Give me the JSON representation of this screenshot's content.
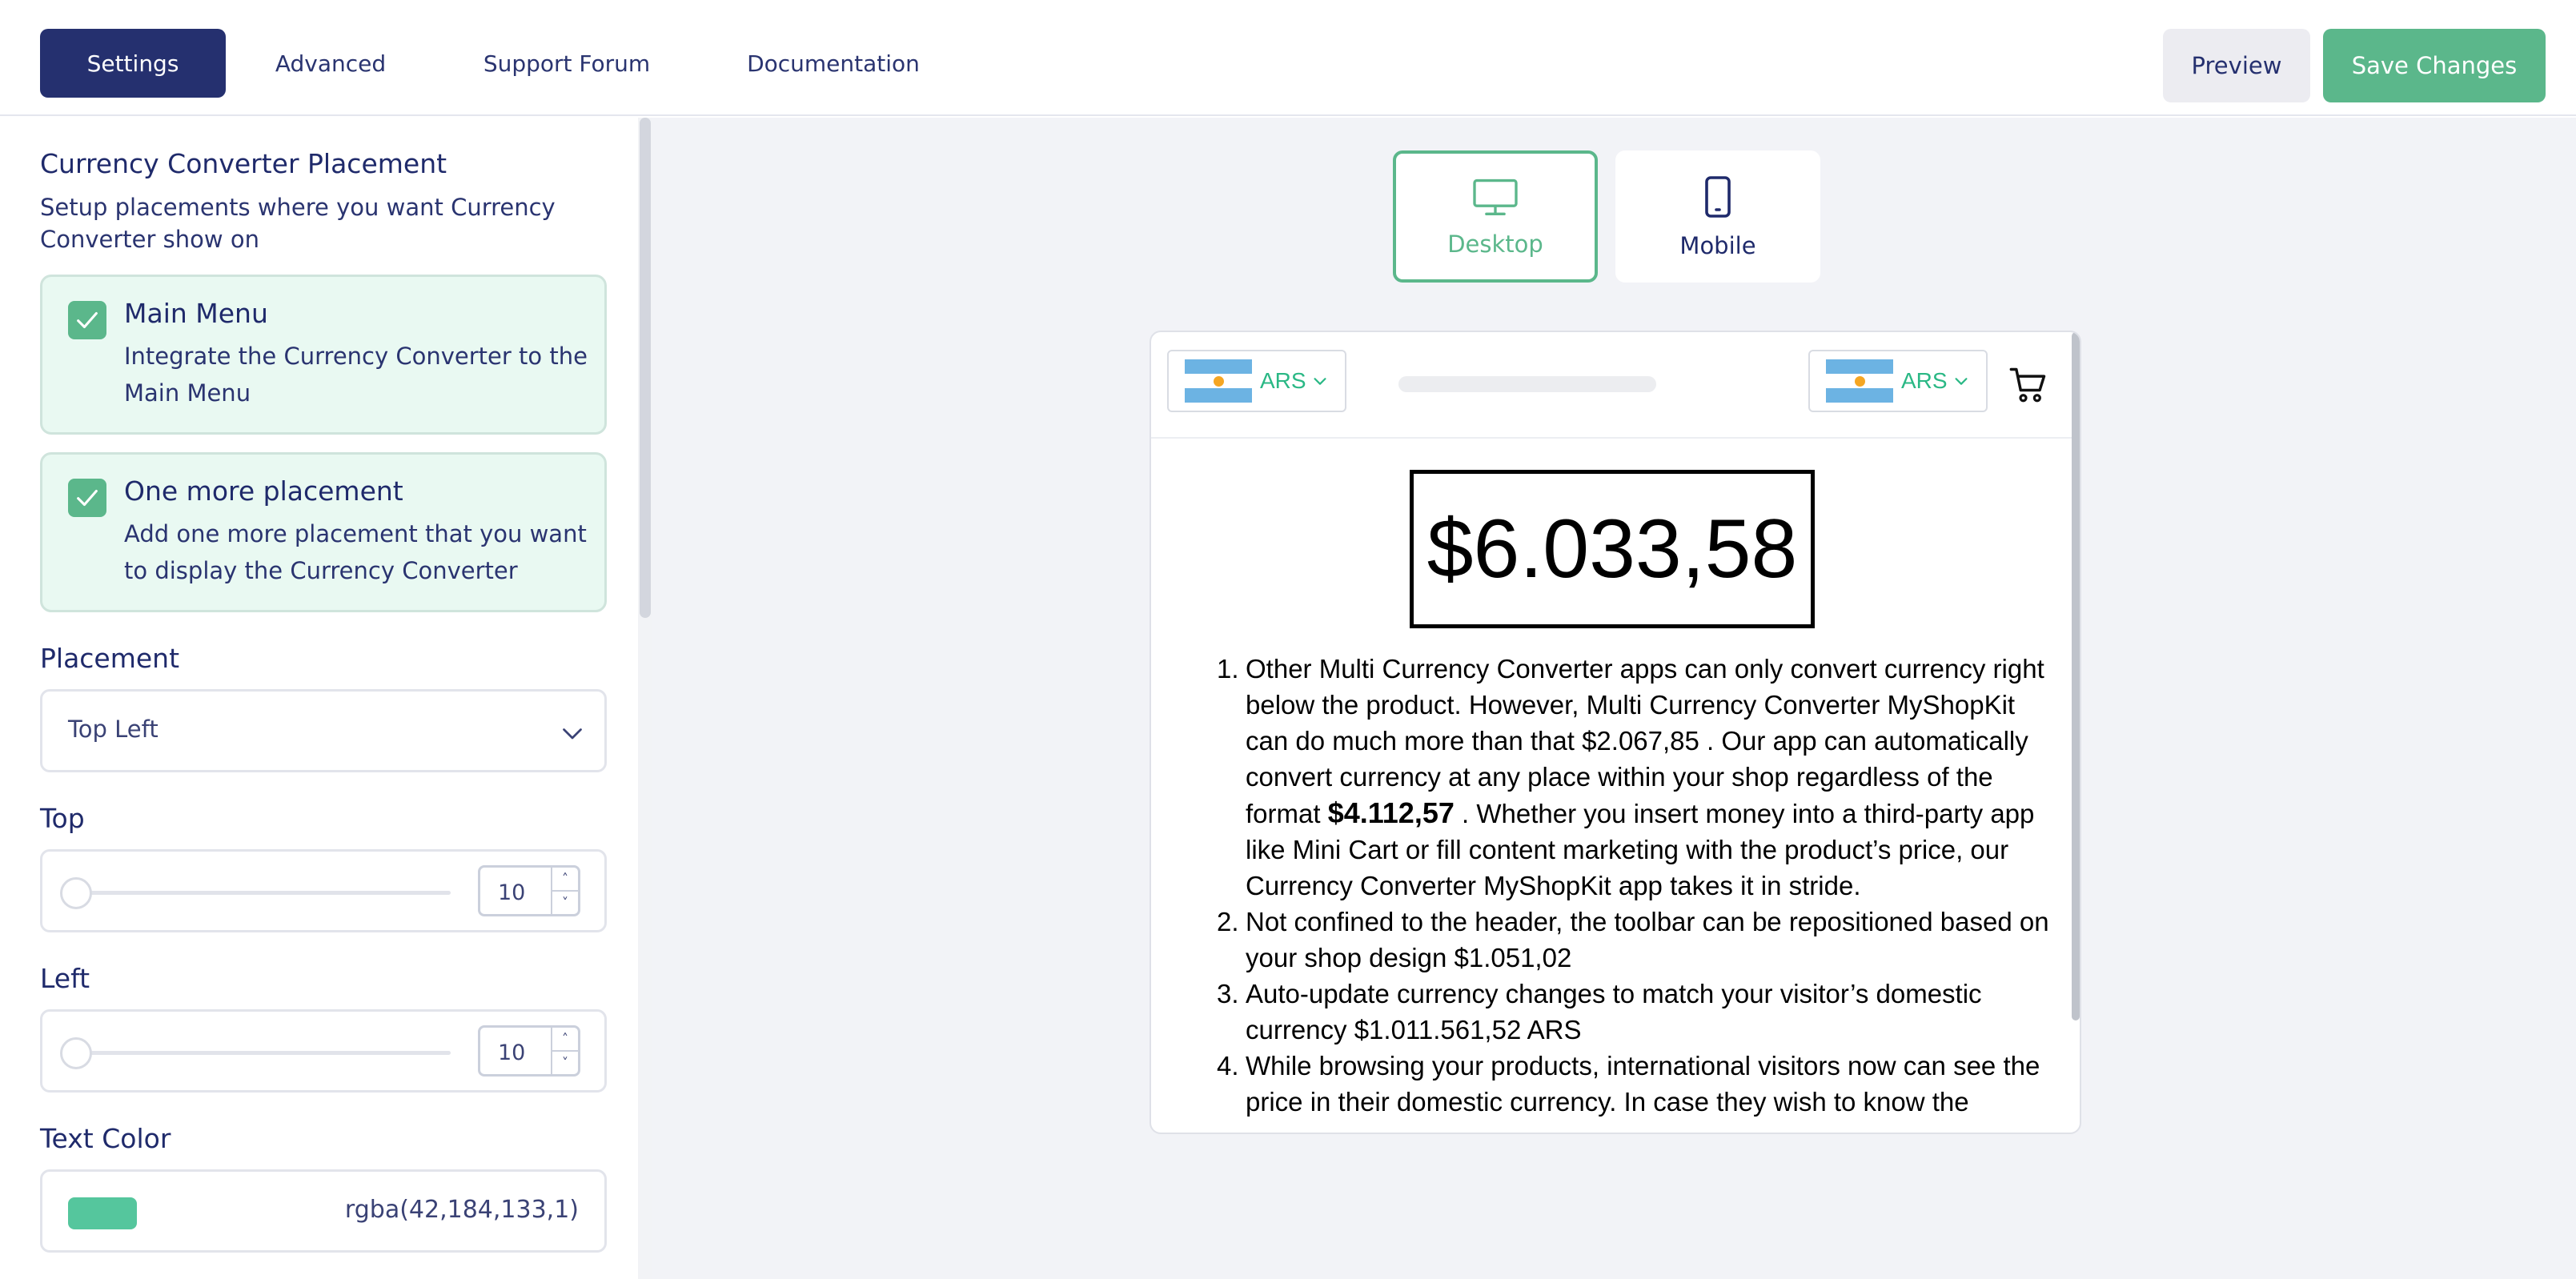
{
  "top_nav": {
    "tabs": [
      {
        "label": "Settings",
        "active": true
      },
      {
        "label": "Advanced",
        "active": false
      },
      {
        "label": "Support Forum",
        "active": false
      },
      {
        "label": "Documentation",
        "active": false
      }
    ],
    "preview_label": "Preview",
    "save_label": "Save Changes"
  },
  "sidebar": {
    "section_title": "Currency Converter Placement",
    "section_desc": "Setup placements where you want Currency Converter show on",
    "cards": [
      {
        "title": "Main Menu",
        "desc": "Integrate the Currency Converter to the Main Menu",
        "checked": true
      },
      {
        "title": "One more placement",
        "desc": "Add one more placement that you want to display the Currency Converter",
        "checked": true
      }
    ],
    "placement": {
      "label": "Placement",
      "value": "Top Left"
    },
    "top": {
      "label": "Top",
      "value": "10",
      "up": "˄",
      "down": "˅"
    },
    "left": {
      "label": "Left",
      "value": "10",
      "up": "˄",
      "down": "˅"
    },
    "text_color": {
      "label": "Text Color",
      "value": "rgba(42,184,133,1)",
      "swatch": "#2ab885"
    }
  },
  "preview": {
    "device_tabs": [
      {
        "label": "Desktop",
        "icon": "desktop-icon",
        "active": true
      },
      {
        "label": "Mobile",
        "icon": "mobile-icon",
        "active": false
      }
    ],
    "currency_left": "ARS",
    "currency_right": "ARS",
    "main_price": "$6.033,58",
    "list": [
      {
        "num": "1.",
        "before": "Other Multi Currency Converter apps can only convert currency right below the product. However, Multi Currency Converter MyShopKit can do much more than that $2.067,85 . Our app can automatically convert currency at any place within your shop regardless of the format ",
        "bold": "$4.112,57",
        "after": " . Whether you insert money into a third-party app like Mini Cart or fill content marketing with the product’s price, our Currency Converter MyShopKit app takes it in stride."
      },
      {
        "num": "2.",
        "before": "Not confined to the header, the toolbar can be repositioned based on your shop design $1.051,02",
        "bold": "",
        "after": ""
      },
      {
        "num": "3.",
        "before": "Auto-update currency changes to match your visitor’s domestic currency $1.011.561,52 ARS",
        "bold": "",
        "after": ""
      },
      {
        "num": "4.",
        "before": "While browsing your products, international visitors now can see the price in their domestic currency. In case they wish to know the",
        "bold": "",
        "after": ""
      }
    ]
  },
  "colors": {
    "brand_navy": "#25306f",
    "accent_green": "#5bb78b",
    "converter_green": "#2ab885"
  }
}
